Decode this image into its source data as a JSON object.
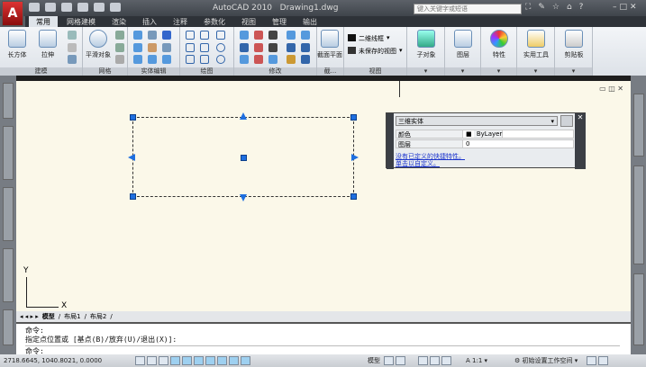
{
  "title": {
    "app": "AutoCAD 2010",
    "file": "Drawing1.dwg",
    "search_placeholder": "键入关键字或短语"
  },
  "tabs": [
    "常用",
    "网格建模",
    "渲染",
    "插入",
    "注释",
    "参数化",
    "视图",
    "管理",
    "输出"
  ],
  "panels": {
    "modeling": "建模",
    "mesh": "网格",
    "solid_edit": "实体编辑",
    "draw": "绘图",
    "modify": "修改",
    "section": "截...",
    "view": "视图"
  },
  "buttons": {
    "box": "长方体",
    "extrude": "拉伸",
    "smooth": "平滑对象",
    "section_plane": "截面平面",
    "visual_style": "二维线框",
    "saved_view": "未保存的视图",
    "subobject": "子对象",
    "layers": "图层",
    "properties": "特性",
    "utilities": "实用工具",
    "clipboard": "剪贴板"
  },
  "quick_props": {
    "type": "三维实体",
    "rows": [
      {
        "label": "颜色",
        "value": "ByLayer"
      },
      {
        "label": "图层",
        "value": "0"
      }
    ],
    "link1": "没有已定义的快捷特性。",
    "link2": "单击以自定义。"
  },
  "ucs": {
    "x": "X",
    "y": "Y"
  },
  "layout_tabs": [
    "模型",
    "布局1",
    "布局2"
  ],
  "command": {
    "line1": "命令:",
    "line2": "指定点位置或 [基点(B)/放弃(U)/退出(X)]:",
    "prompt": "命令:"
  },
  "status": {
    "coords": "2718.6645, 1040.8021, 0.0000",
    "model": "模型",
    "scale": "1:1",
    "workspace": "初始设置工作空间"
  }
}
